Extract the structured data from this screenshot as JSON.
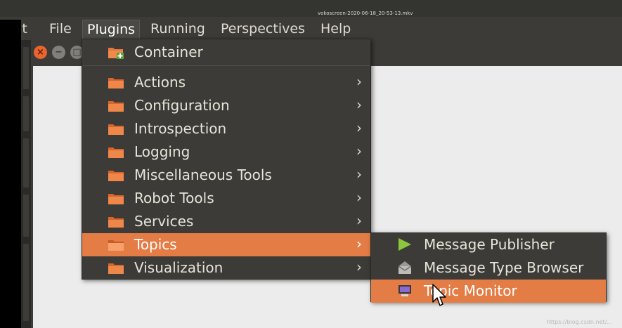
{
  "video_title": "vokoscreen-2020-06-18_20-53-13.mkv",
  "menubar": {
    "items": [
      {
        "label": "ult"
      },
      {
        "label": "File"
      },
      {
        "label": "Plugins"
      },
      {
        "label": "Running"
      },
      {
        "label": "Perspectives"
      },
      {
        "label": "Help"
      }
    ],
    "active": "Plugins"
  },
  "window_buttons": {
    "close": "×",
    "minimize": "−",
    "maximize": "□"
  },
  "plugins_menu": {
    "header_item": {
      "label": "Container",
      "icon": "folder-add-icon"
    },
    "items": [
      {
        "label": "Actions",
        "submenu": true,
        "icon": "folder-icon"
      },
      {
        "label": "Configuration",
        "submenu": true,
        "icon": "folder-icon"
      },
      {
        "label": "Introspection",
        "submenu": true,
        "icon": "folder-icon"
      },
      {
        "label": "Logging",
        "submenu": true,
        "icon": "folder-icon"
      },
      {
        "label": "Miscellaneous Tools",
        "submenu": true,
        "icon": "folder-icon"
      },
      {
        "label": "Robot Tools",
        "submenu": true,
        "icon": "folder-icon"
      },
      {
        "label": "Services",
        "submenu": true,
        "icon": "folder-icon"
      },
      {
        "label": "Topics",
        "submenu": true,
        "icon": "folder-icon",
        "highlighted": true
      },
      {
        "label": "Visualization",
        "submenu": true,
        "icon": "folder-icon"
      }
    ],
    "arrow": "›"
  },
  "topics_submenu": {
    "items": [
      {
        "label": "Message Publisher",
        "icon": "play-icon"
      },
      {
        "label": "Message Type Browser",
        "icon": "envelope-icon"
      },
      {
        "label": "Topic Monitor",
        "icon": "monitor-icon",
        "highlighted": true
      }
    ]
  },
  "watermark": "https://blog.csdn.net/...",
  "colors": {
    "highlight": "#e47c45",
    "menu_bg": "#3c3b37",
    "text": "#e8e4da",
    "folder": "#e8763b"
  }
}
